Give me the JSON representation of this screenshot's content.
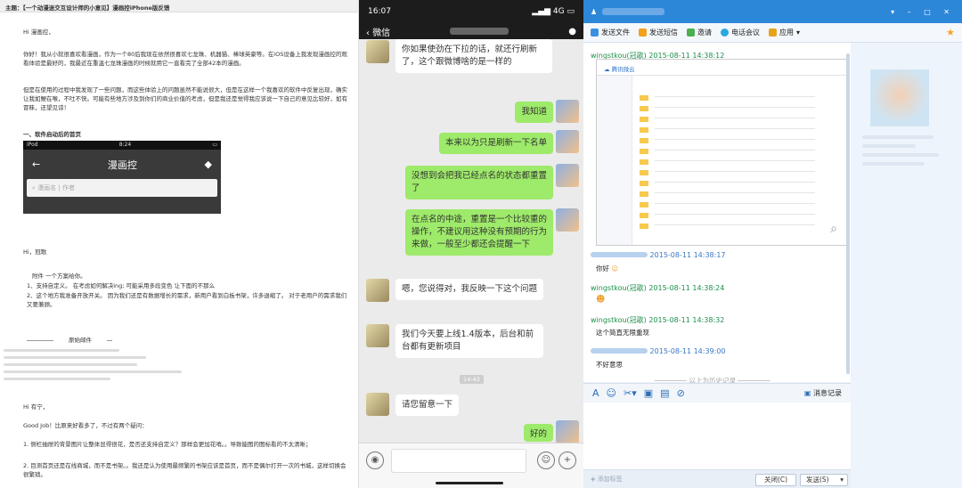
{
  "email": {
    "subject": "主题：【一个动漫迷交互设计师的小意见】漫画控iPhone版反馈",
    "greeting": "Hi 漫画控，",
    "para1": "你好！我从小就很喜欢看漫画，作为一个80后我现在依然很喜欢七龙珠、机器猫、棒球英豪等。在iOS设备上我发现漫画控的观看体验是最好的，我最近在重温七龙珠漫画的时候就用它一直看完了全部42本的漫画。",
    "para2": "但是在使用的过程中我发现了一些问题，而这些体验上的问题虽然不能说很大，但是在这样一个我喜欢的软件中反复出现，确实让我如鲠在喉，不吐不快。可能有些地方涉及到你们的商业价值的考虑，但是我还是觉得我应该说一下自己的意见比较好，如有冒昧，还望见谅！",
    "section": "一、软件启动后的首页",
    "phone": {
      "carrier": "iPod",
      "time": "8:24",
      "title": "漫画控",
      "search_placeholder": "漫画名 | 作者"
    },
    "reply_greeting": "Hi，冠歌",
    "reply_intro": "附件 一个方案给你。",
    "reply_item1": "1、支持自定义。  在考虑如何解决ing; 可能采用多段变色 让下面的不那么",
    "reply_item2": "2、这个地方我准备开放开关。 因为我们还是有数据增长的需求，新用户看到白板书架，许多退缩了。 对于老用户的需求我们又要兼顾。",
    "forward": "原始邮件",
    "reply2_greeting": "Hi 有宁，",
    "reply2_intro": "Good Job！比原来好看多了，不过有两个疑问：",
    "reply2_item1": "1. 侧栏抽屉的背景图片让整体显得很花，是否还支持自定义？那样会更加花哨。。导致能图的图标看的不太清晰；",
    "reply2_item2": "2. 目测首页还是在线商城，而不是书架。。我还是认为使用最频繁的书架应该是首页，而不是偶尔打开一次的书城，这样切换会很繁琐。"
  },
  "wechat": {
    "status_time": "16:07",
    "signal": "4G",
    "back_label": "微信",
    "messages": [
      {
        "side": "left",
        "text": "你如果使劲在下拉的话，就还行刷新了，这个跟微博啥的是一样的"
      },
      {
        "side": "right",
        "text": "我知道"
      },
      {
        "side": "right",
        "text": "本来以为只是刷新一下名单"
      },
      {
        "side": "right",
        "text": "没想到会把我已经点名的状态都重置了"
      },
      {
        "side": "right",
        "text": "在点名的中途，重置是一个比较重的操作，不建议用这种没有预期的行为来做，一般至少都还会提醒一下"
      },
      {
        "side": "left",
        "text": "嗯，您说得对，我反映一下这个问题"
      },
      {
        "side": "left",
        "text": "我们今天要上线1.4版本，后台和前台都有更新项目"
      },
      {
        "side": "left",
        "text": "请您留意一下"
      },
      {
        "side": "right",
        "text": "好的"
      }
    ],
    "timestamp": "14:43"
  },
  "qq": {
    "toolbar": [
      "发送文件",
      "发送短信",
      "邀请",
      "电话会议",
      "应用"
    ],
    "entries": [
      {
        "name": "wingstkou(冠歌)",
        "time": "2015-08-11 14:38:12",
        "text": ""
      },
      {
        "name": "",
        "time": "2015-08-11 14:38:17",
        "text": "你好"
      },
      {
        "name": "wingstkou(冠歌)",
        "time": "2015-08-11 14:38:24",
        "text": ""
      },
      {
        "name": "wingstkou(冠歌)",
        "time": "2015-08-11 14:38:32",
        "text": "这个简直无限重现"
      },
      {
        "name": "",
        "time": "2015-08-11 14:39:00",
        "text": "不好意思"
      }
    ],
    "shot_app": "腾讯微云",
    "history_label": "以上为历史记录",
    "message_log": "消息记录",
    "add_tag": "添加标签",
    "close_button": "关闭(C)",
    "send_button": "发送(S)"
  },
  "colors": {
    "qq_blue": "#2d87d9",
    "wechat_green": "#9eea6a",
    "qq_name_green": "#1e8f4b"
  }
}
